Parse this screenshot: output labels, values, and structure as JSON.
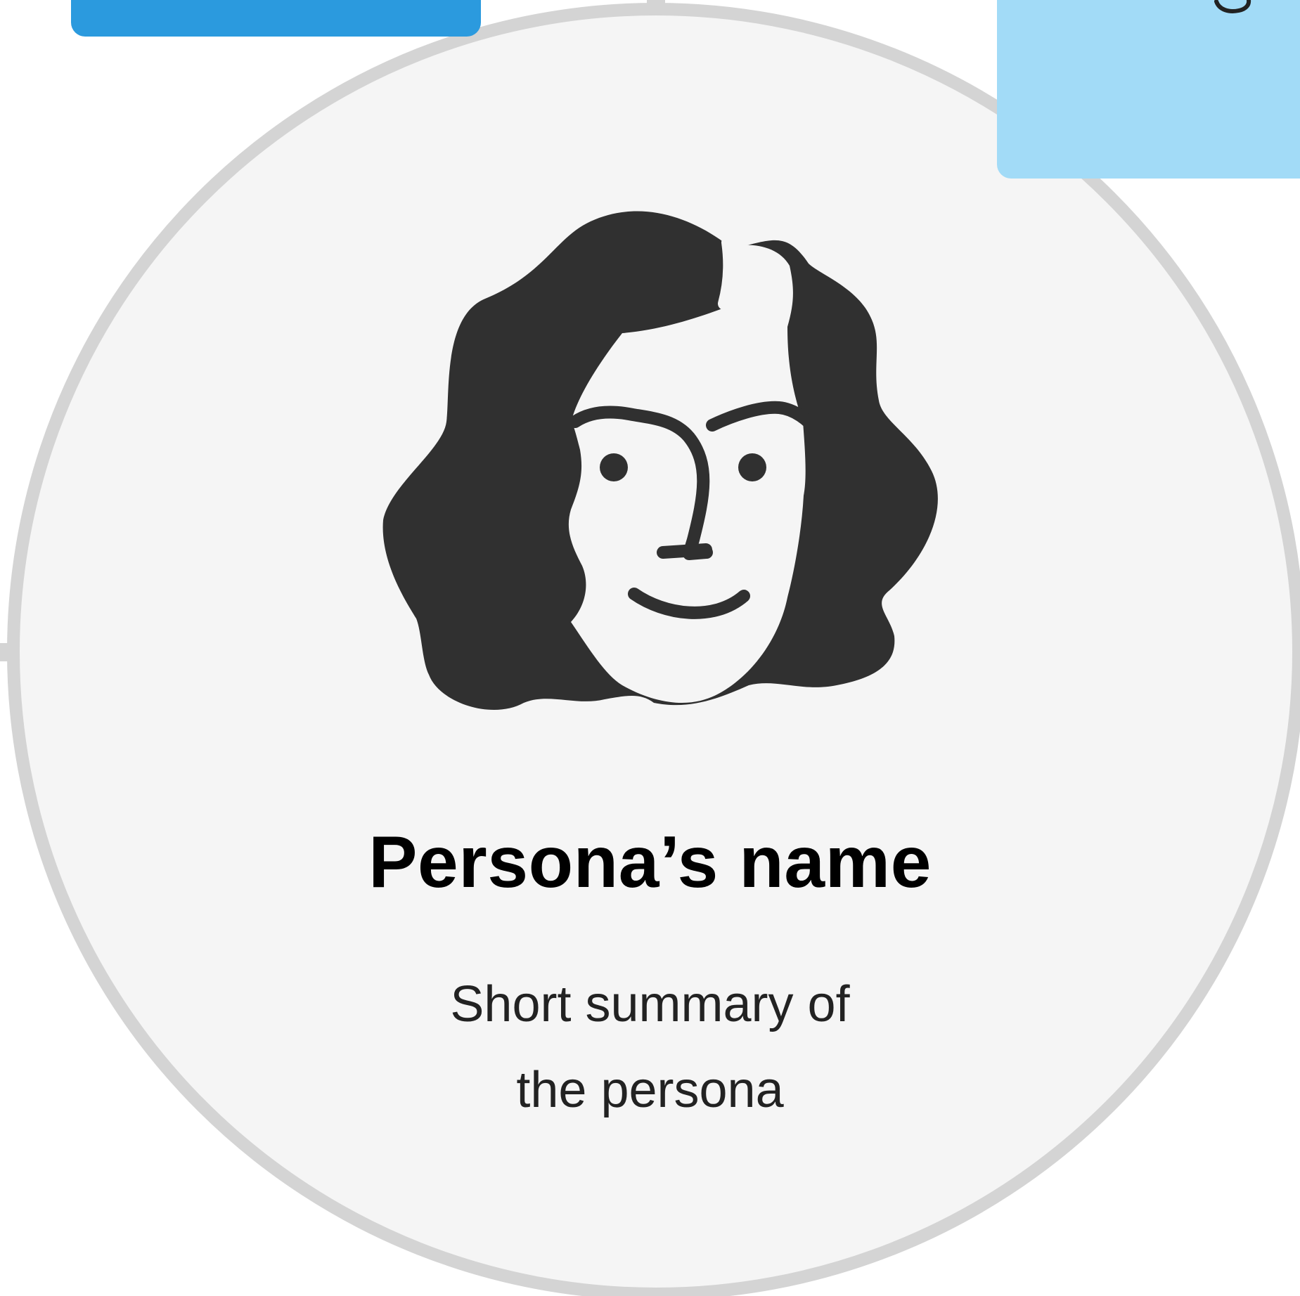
{
  "persona": {
    "name": "Persona’s name",
    "summary_line_1": "Short summary of",
    "summary_line_2": "the persona"
  },
  "icons": {
    "portrait": "woman-face-icon"
  },
  "colors": {
    "card_fill": "#f5f5f5",
    "card_border": "#d4d4d4",
    "sticky_note_dark": "#2b9ade",
    "sticky_note_light": "#a2dbf7",
    "illustration": "#303030"
  }
}
